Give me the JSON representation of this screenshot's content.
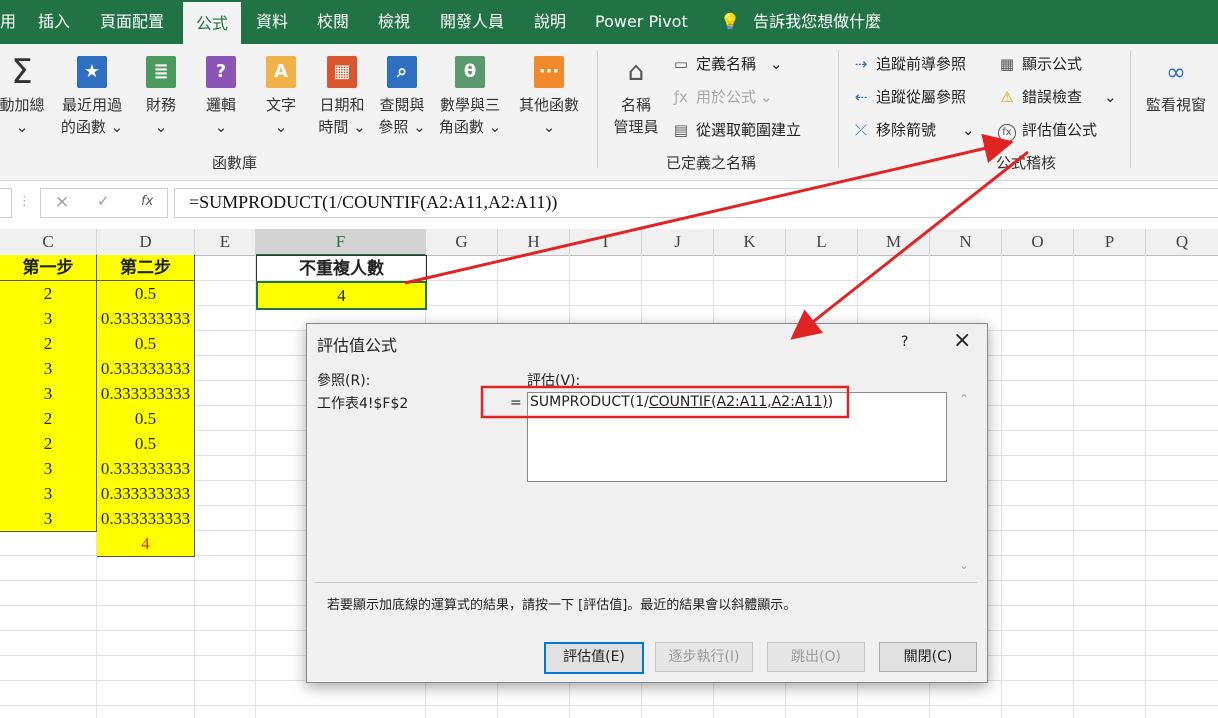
{
  "ribbon_tabs": [
    {
      "label": "用"
    },
    {
      "label": "插入"
    },
    {
      "label": "頁面配置"
    },
    {
      "label": "公式",
      "active": true
    },
    {
      "label": "資料"
    },
    {
      "label": "校閱"
    },
    {
      "label": "檢視"
    },
    {
      "label": "開發人員"
    },
    {
      "label": "說明"
    },
    {
      "label": "Power Pivot"
    },
    {
      "label": "告訴我您想做什麼"
    }
  ],
  "ribbon": {
    "function_library": {
      "buttons": [
        {
          "l1": "動加總",
          "l2": "⌄",
          "icon": "sigma-icon"
        },
        {
          "l1": "最近用過",
          "l2": "的函數 ⌄",
          "icon": "star-book-icon"
        },
        {
          "l1": "財務",
          "l2": "⌄",
          "icon": "coins-book-icon"
        },
        {
          "l1": "邏輯",
          "l2": "⌄",
          "icon": "question-book-icon"
        },
        {
          "l1": "文字",
          "l2": "⌄",
          "icon": "text-book-icon"
        },
        {
          "l1": "日期和",
          "l2": "時間 ⌄",
          "icon": "calendar-book-icon"
        },
        {
          "l1": "查閱與",
          "l2": "參照 ⌄",
          "icon": "search-book-icon"
        },
        {
          "l1": "數學與三",
          "l2": "角函數 ⌄",
          "icon": "theta-book-icon"
        },
        {
          "l1": "其他函數",
          "l2": "⌄",
          "icon": "more-book-icon"
        }
      ],
      "group_label": "函數庫"
    },
    "defined_names": {
      "name_manager_l1": "名稱",
      "name_manager_l2": "管理員",
      "define_name": "定義名稱",
      "use_in_formula": "用於公式",
      "create_from_selection": "從選取範圍建立",
      "group_label": "已定義之名稱"
    },
    "formula_auditing": {
      "trace_precedents": "追蹤前導參照",
      "trace_dependents": "追蹤從屬參照",
      "remove_arrows": "移除箭號",
      "show_formulas": "顯示公式",
      "error_checking": "錯誤檢查",
      "evaluate_formula": "評估值公式",
      "group_label": "公式稽核"
    },
    "watch_window": "監看視窗"
  },
  "formula_bar": {
    "cancel": "×",
    "enter": "✓",
    "fx": "fx",
    "formula": "=SUMPRODUCT(1/COUNTIF(A2:A11,A2:A11))"
  },
  "sheet": {
    "columns": [
      "C",
      "D",
      "E",
      "F",
      "G",
      "H",
      "I",
      "J",
      "K",
      "L",
      "M",
      "N",
      "O",
      "P",
      "Q"
    ],
    "header_c": "第一步",
    "header_d": "第二步",
    "rows": [
      {
        "c": "2",
        "d": "0.5"
      },
      {
        "c": "3",
        "d": "0.333333333"
      },
      {
        "c": "2",
        "d": "0.5"
      },
      {
        "c": "3",
        "d": "0.333333333"
      },
      {
        "c": "3",
        "d": "0.333333333"
      },
      {
        "c": "2",
        "d": "0.5"
      },
      {
        "c": "2",
        "d": "0.5"
      },
      {
        "c": "3",
        "d": "0.333333333"
      },
      {
        "c": "3",
        "d": "0.333333333"
      },
      {
        "c": "3",
        "d": "0.333333333"
      }
    ],
    "d_total": "4",
    "f_header": "不重複人數",
    "f_value": "4"
  },
  "dialog": {
    "title": "評估值公式",
    "help": "?",
    "close": "×",
    "reference_label": "參照(R):",
    "reference_value": "工作表4!$F$2",
    "evaluation_label": "評估(V):",
    "equals": "=",
    "expression_prefix": "SUMPRODUCT(1/",
    "expression_underlined": "COUNTIF(A2:A11,A2:A11)",
    "expression_suffix": ")",
    "hint": "若要顯示加底線的運算式的結果，請按一下 [評估值]。最近的結果會以斜體顯示。",
    "buttons": {
      "evaluate": "評估值(E)",
      "step_in": "逐步執行(I)",
      "step_out": "跳出(O)",
      "close": "關閉(C)"
    }
  },
  "colors": {
    "excel_green": "#217346",
    "highlight_yellow": "#ffff00",
    "annotation_red": "#e02424"
  }
}
